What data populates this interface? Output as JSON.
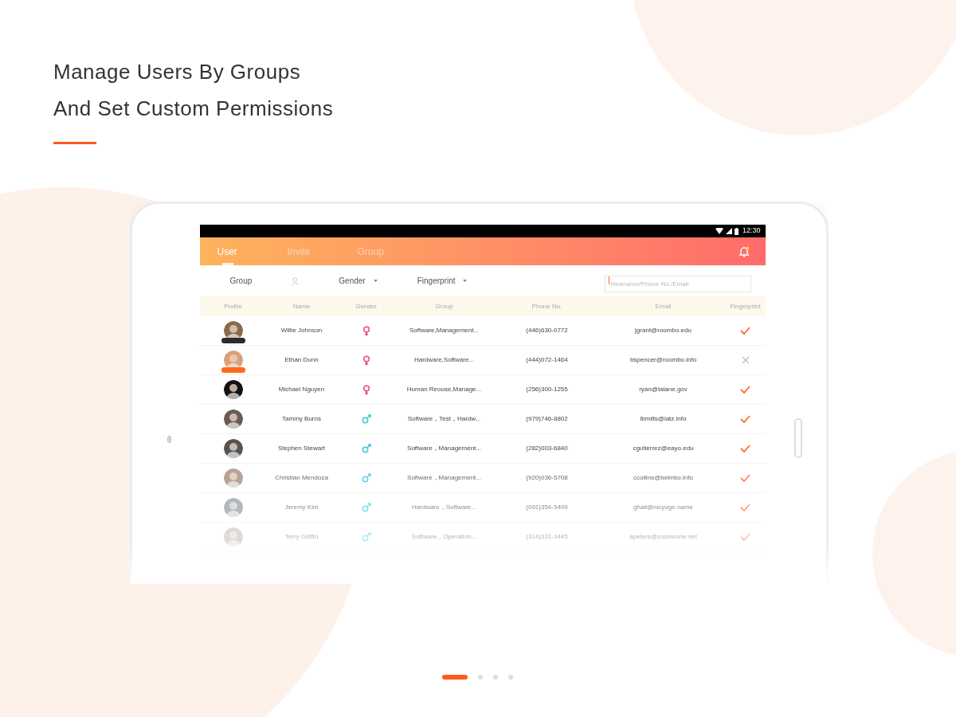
{
  "headline": [
    "Manage Users By Groups",
    "And Set Custom Permissions"
  ],
  "status_bar": {
    "time": "12:30"
  },
  "tabs": [
    {
      "label": "User",
      "selected": true
    },
    {
      "label": "Invite",
      "selected": false
    },
    {
      "label": "Group",
      "selected": false
    }
  ],
  "filters": [
    {
      "label": "Group",
      "kind": "icon"
    },
    {
      "label": "Gender",
      "kind": "dropdown"
    },
    {
      "label": "Fingerprint",
      "kind": "dropdown"
    }
  ],
  "search": {
    "placeholder": "Nickname/Phone No./Email"
  },
  "table": {
    "columns": [
      "Profile",
      "Name",
      "Gender",
      "Group",
      "Phone No.",
      "Email",
      "Fingerprint"
    ],
    "rows": [
      {
        "name": "Willie Johnson",
        "kind": "female",
        "group": "Software,Management...",
        "phone": "(446)630-0772",
        "email": "jgrant@roombo.edu",
        "fingerprint": true,
        "color": "#2b2b2b"
      },
      {
        "name": "Ethan Dunn",
        "kind": "female",
        "group": "Hardware,Software...",
        "phone": "(444)072-1464",
        "email": "bspencer@roombo.info",
        "fingerprint": false,
        "color": "#ff6a1a"
      },
      {
        "name": "Michael Nguyen",
        "kind": "female",
        "group": "Human Reouse,Manage...",
        "phone": "(256)300-1255",
        "email": "ryan@talane.gov",
        "fingerprint": true
      },
      {
        "name": "Tammy Burns",
        "kind": "male",
        "group": "Software，Test，Hardw...",
        "phone": "(979)746-8802",
        "email": "lbmills@latz.info",
        "fingerprint": true
      },
      {
        "name": "Stephen Stewart",
        "kind": "male",
        "group": "Software，Management...",
        "phone": "(282)003-6840",
        "email": "cgutierrez@eayo.edu",
        "fingerprint": true
      },
      {
        "name": "Christian Mendoza",
        "kind": "male",
        "group": "Software，Management...",
        "phone": "(920)036-5708",
        "email": "ccollins@twimbo.info",
        "fingerprint": true
      },
      {
        "name": "Jeremy Kim",
        "kind": "male",
        "group": "Hardware，Software...",
        "phone": "(091)354-5499",
        "email": "ghall@nicyuge.name",
        "fingerprint": true
      },
      {
        "name": "Terry Griffin",
        "kind": "male",
        "group": "Software，Operation...",
        "phone": "(314)331-3445",
        "email": "apeters@zoomzone.net",
        "fingerprint": true
      }
    ]
  },
  "pager": [
    {
      "selected": true
    },
    {
      "selected": false
    },
    {
      "selected": false
    },
    {
      "selected": false
    }
  ]
}
